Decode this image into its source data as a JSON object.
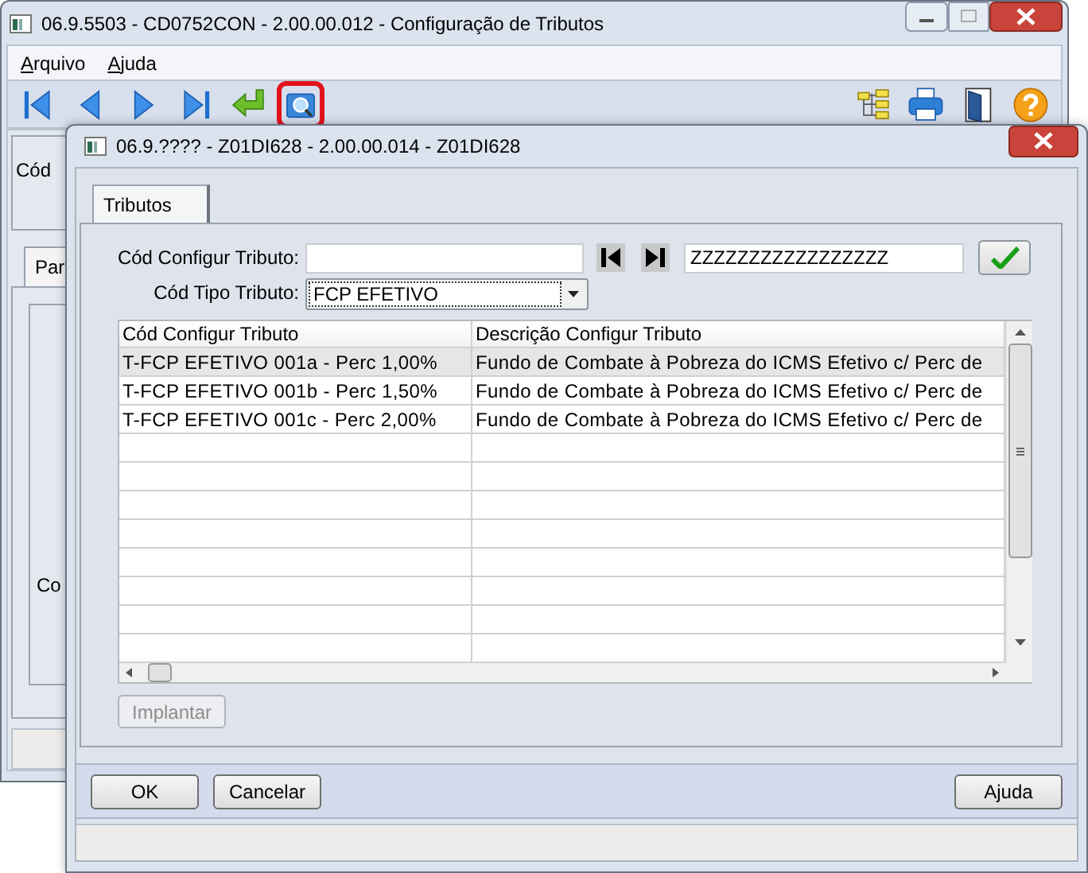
{
  "main_window": {
    "title": "06.9.5503 - CD0752CON - 2.00.00.012 - Configuração de Tributos",
    "menu": [
      {
        "label": "Arquivo"
      },
      {
        "label": "Ajuda"
      }
    ],
    "toolbar": [
      {
        "kind": "first",
        "highlighted": false
      },
      {
        "kind": "prev",
        "highlighted": false
      },
      {
        "kind": "next",
        "highlighted": false
      },
      {
        "kind": "last",
        "highlighted": false
      },
      {
        "kind": "return",
        "highlighted": false
      },
      {
        "kind": "search",
        "highlighted": true
      },
      {
        "kind": "tree",
        "highlighted": false
      },
      {
        "kind": "print",
        "highlighted": false
      },
      {
        "kind": "exit",
        "highlighted": false
      },
      {
        "kind": "help",
        "highlighted": false
      }
    ],
    "group_label": "Cód",
    "tab_label": "Par",
    "field_label": "Co"
  },
  "dialog": {
    "title": "06.9.???? - Z01DI628 - 2.00.00.014 - Z01DI628",
    "tabs": [
      {
        "label": "Tributos",
        "selected": true
      }
    ],
    "cod_configur_tributo": {
      "label": "Cód Configur Tributo:",
      "to": "ZZZZZZZZZZZZZZZZZ"
    },
    "cod_tipo_tributo": {
      "label": "Cód Tipo Tributo:",
      "value": "FCP EFETIVO"
    },
    "table": {
      "columns": [
        "Cód Configur Tributo",
        "Descrição Configur Tributo"
      ],
      "rows": [
        {
          "cells": [
            "T-FCP EFETIVO 001a - Perc 1,00%",
            "Fundo de Combate à Pobreza do ICMS Efetivo c/ Perc de"
          ],
          "selected": true
        },
        {
          "cells": [
            "T-FCP EFETIVO 001b - Perc 1,50%",
            "Fundo de Combate à Pobreza do ICMS Efetivo c/ Perc de"
          ],
          "selected": false
        },
        {
          "cells": [
            "T-FCP EFETIVO 001c - Perc 2,00%",
            "Fundo de Combate à Pobreza do ICMS Efetivo c/ Perc de"
          ],
          "selected": false
        }
      ]
    },
    "implantar": {
      "label": "Implantar",
      "disabled": true
    },
    "buttons": [
      {
        "label": "OK"
      },
      {
        "label": "Cancelar"
      }
    ],
    "help_button": {
      "label": "Ajuda"
    }
  }
}
